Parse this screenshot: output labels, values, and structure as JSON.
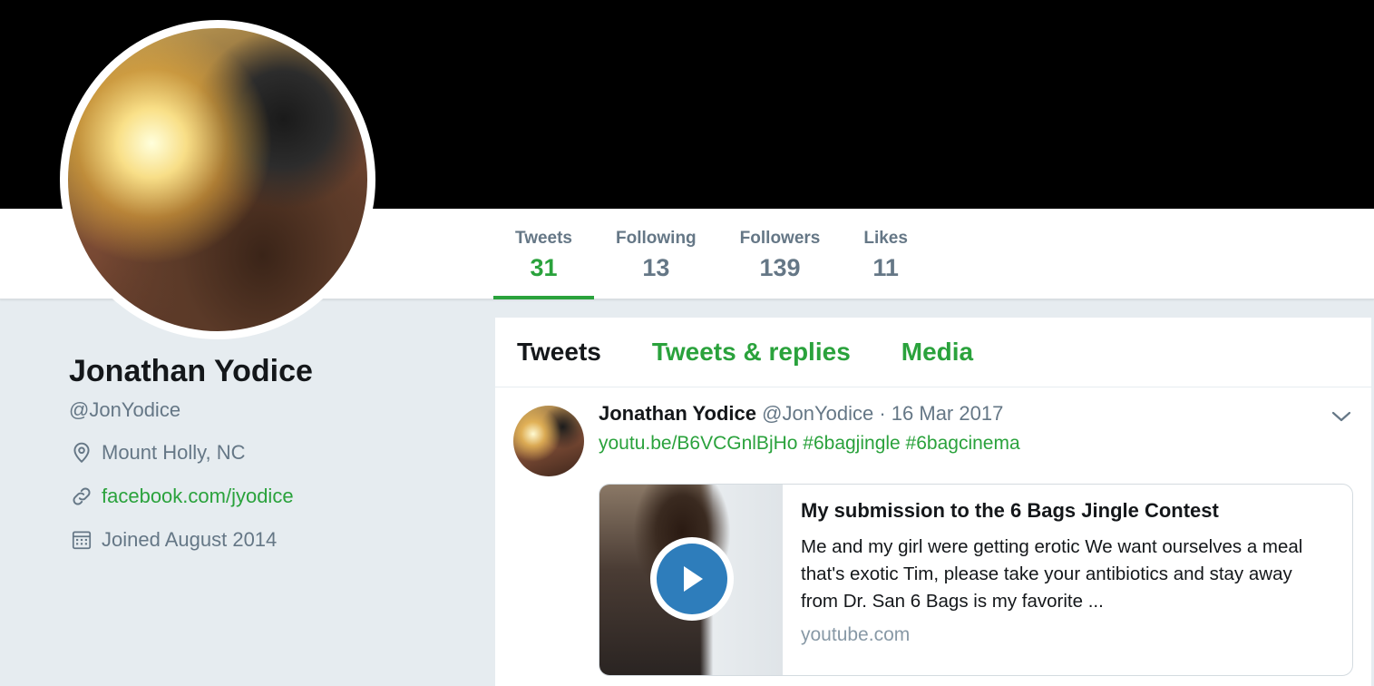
{
  "profile": {
    "name": "Jonathan Yodice",
    "handle": "@JonYodice",
    "location": "Mount Holly, NC",
    "website": "facebook.com/jyodice",
    "joined": "Joined August 2014"
  },
  "stats": [
    {
      "label": "Tweets",
      "value": "31",
      "active": true
    },
    {
      "label": "Following",
      "value": "13"
    },
    {
      "label": "Followers",
      "value": "139"
    },
    {
      "label": "Likes",
      "value": "11"
    }
  ],
  "tabs": {
    "tweets": "Tweets",
    "replies": "Tweets & replies",
    "media": "Media"
  },
  "tweet": {
    "name": "Jonathan Yodice",
    "handle": "@JonYodice",
    "separator": "·",
    "date": "16 Mar 2017",
    "text": "youtu.be/B6VCGnlBjHo #6bagjingle #6bagcinema",
    "card": {
      "title": "My submission to the 6 Bags Jingle Contest",
      "description": "Me and my girl were getting erotic We want ourselves a meal that's exotic Tim, please take your antibiotics and stay away from Dr. San 6 Bags is my favorite ...",
      "domain": "youtube.com"
    }
  },
  "colors": {
    "accent": "#2aa23c",
    "text": "#14171a",
    "muted": "#657786",
    "background": "#e6ecf0",
    "play_button": "#2e7dbb"
  },
  "icons": {
    "location": "location-pin-icon",
    "link": "link-icon",
    "calendar": "calendar-icon",
    "caret": "chevron-down-icon",
    "play": "play-icon"
  }
}
